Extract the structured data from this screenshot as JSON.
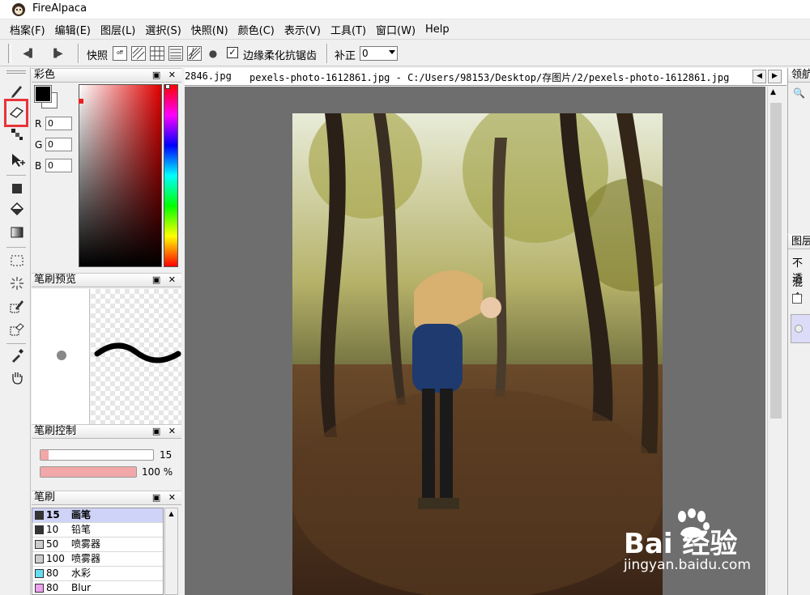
{
  "app": {
    "title": "FireAlpaca"
  },
  "menubar": {
    "items": [
      "档案(F)",
      "编辑(E)",
      "图层(L)",
      "選択(S)",
      "快照(N)",
      "颜色(C)",
      "表示(V)",
      "工具(T)",
      "窗口(W)",
      "Help"
    ]
  },
  "toolbar": {
    "snap_label": "快照",
    "antialias_label": "边缘柔化抗锯齿",
    "antialias_checked": "✓",
    "correct_label": "补正",
    "correct_value": "0"
  },
  "color_panel": {
    "title": "彩色",
    "controls": "▣ ✕",
    "r_label": "R",
    "r_value": "0",
    "g_label": "G",
    "g_value": "0",
    "b_label": "B",
    "b_value": "0",
    "fg_color": "#000000",
    "bg_color": "#ffffff"
  },
  "brush_preview": {
    "title": "笔刷预览",
    "controls": "▣ ✕"
  },
  "brush_control": {
    "title": "笔刷控制",
    "controls": "▣ ✕",
    "size_value": "15",
    "size_fraction": 0.07,
    "opacity_value": "100 %",
    "opacity_fraction": 1.0
  },
  "brush_panel": {
    "title": "笔刷",
    "controls": "▣ ✕",
    "items": [
      {
        "size": "15",
        "name": "画笔",
        "color": "#333333"
      },
      {
        "size": "10",
        "name": "铅笔",
        "color": "#333333"
      },
      {
        "size": "50",
        "name": "喷雾器",
        "color": "#cccccc"
      },
      {
        "size": "100",
        "name": "喷雾器",
        "color": "#cccccc"
      },
      {
        "size": "80",
        "name": "水彩",
        "color": "#66ddf0"
      },
      {
        "size": "80",
        "name": "Blur",
        "color": "#f0a0f0"
      }
    ]
  },
  "tabs": {
    "previous": "2846.jpg",
    "active": "pexels-photo-1612861.jpg - C:/Users/98153/Desktop/存图片/2/pexels-photo-1612861.jpg"
  },
  "right_panels": {
    "navigator_title": "领航",
    "layer_title": "图层",
    "opacity_label": "不透",
    "blend_label": "混合"
  },
  "watermark": {
    "brand": "Bai 经验",
    "url": "jingyan.baidu.com"
  }
}
